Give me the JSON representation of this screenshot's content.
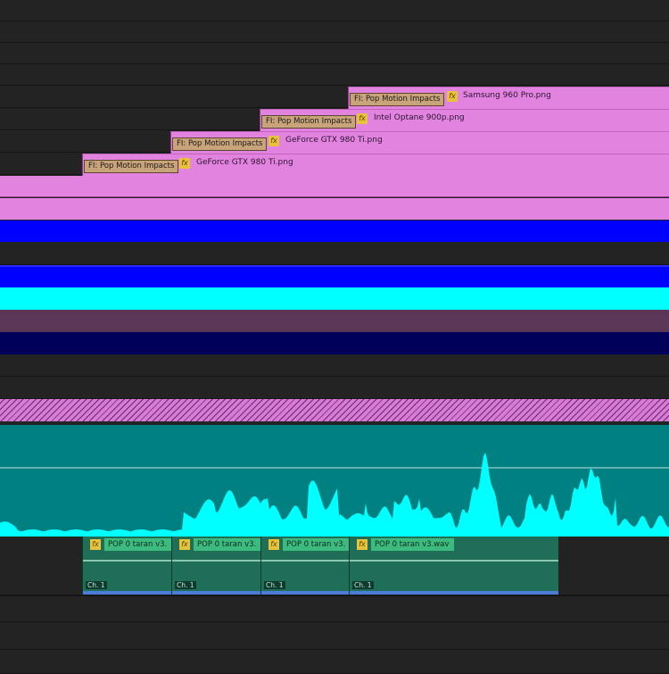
{
  "video_clips": [
    {
      "effect": "FI: Pop Motion Impacts",
      "name": "Samsung 960 Pro.png"
    },
    {
      "effect": "FI: Pop Motion Impacts",
      "name": "Intel Optane 900p.png"
    },
    {
      "effect": "FI: Pop Motion Impacts",
      "name": "GeForce GTX 980 Ti.png"
    },
    {
      "effect": "FI: Pop Motion Impacts",
      "name": "GeForce GTX 980 Ti.png"
    }
  ],
  "fx_symbol": "fx",
  "colors": {
    "background": "#232323",
    "pink_clip": "#e383e0",
    "blue": "#0000ff",
    "cyan": "#00ffff",
    "purple": "#5b3657",
    "navy": "#00005a",
    "audio_bg": "#008080",
    "waveform": "#00ffff",
    "audio_clip": "#1f6e57"
  },
  "audio_clips": [
    {
      "name": "POP 0 taran v3.",
      "channel": "Ch. 1"
    },
    {
      "name": "POP 0 taran v3.",
      "channel": "Ch. 1"
    },
    {
      "name": "POP 0 taran v3.",
      "channel": "Ch. 1"
    },
    {
      "name": "POP 0 taran v3.wav",
      "channel": "Ch. 1"
    }
  ]
}
